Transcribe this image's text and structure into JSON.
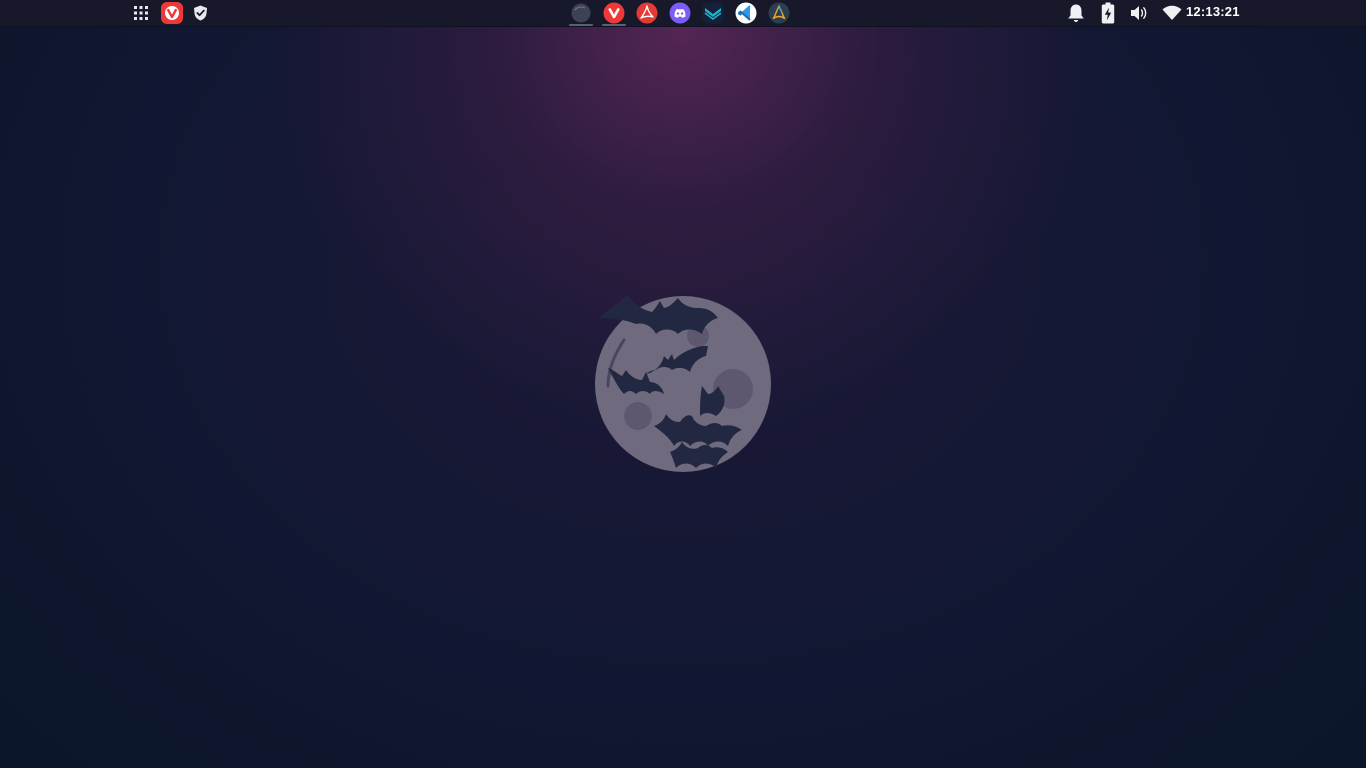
{
  "taskbar": {
    "left": [
      {
        "name": "app-grid-icon"
      },
      {
        "name": "vivaldi-icon",
        "color": "#ef3939"
      },
      {
        "name": "shield-icon"
      }
    ],
    "dock": [
      {
        "name": "moon-app-icon",
        "running": true
      },
      {
        "name": "vivaldi-icon",
        "color": "#ef3939",
        "running": true
      },
      {
        "name": "pdf-reader-icon",
        "color": "#e53935"
      },
      {
        "name": "discord-icon",
        "color": "#7c5cf6"
      },
      {
        "name": "mailspring-icon",
        "color": "#1fb4c5"
      },
      {
        "name": "vscode-icon",
        "color": "#2f9ae3"
      },
      {
        "name": "arch-icon",
        "color": "#2c3e50"
      }
    ],
    "tray": [
      {
        "name": "notification-bell-icon"
      },
      {
        "name": "battery-charging-icon"
      },
      {
        "name": "volume-icon"
      },
      {
        "name": "wifi-icon"
      }
    ],
    "clock": "12:13:21"
  },
  "wallpaper": {
    "moon_color": "#6f6a7e",
    "bat_color": "#232842",
    "icon_name": "bat-moon-wallpaper-icon"
  }
}
